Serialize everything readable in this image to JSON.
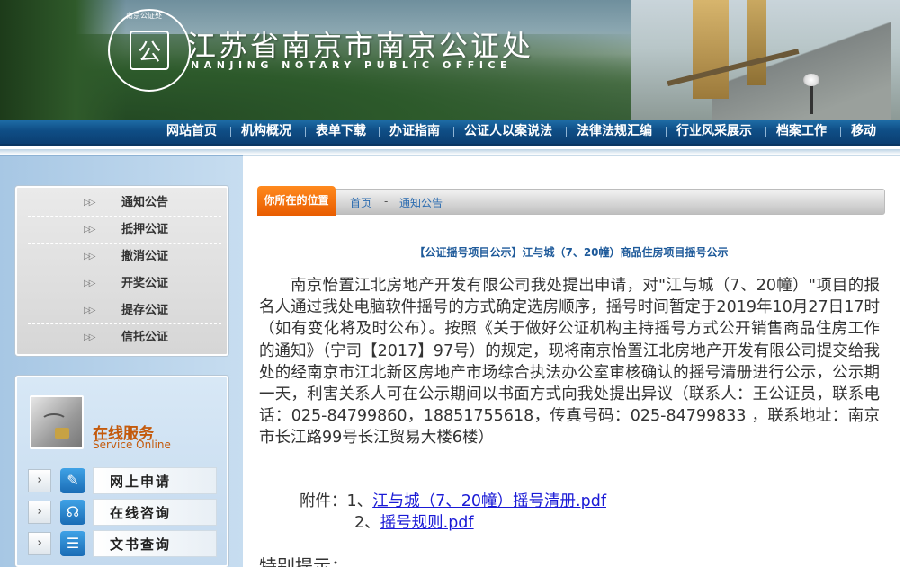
{
  "header": {
    "title_cn": "江苏省南京市南京公证处",
    "title_en": "NANJING NOTARY PUBLIC OFFICE",
    "seal_text_top": "南京公证处",
    "seal_text_ring": "NANJING NOTARY PUBLIC OFFICE"
  },
  "nav": {
    "items": [
      "网站首页",
      "机构概况",
      "表单下载",
      "办证指南",
      "公证人以案说法",
      "法律法规汇编",
      "行业风采展示",
      "档案工作",
      "移动"
    ]
  },
  "sidebar": {
    "menu": [
      {
        "arrow": "▷▷",
        "label": "通知公告"
      },
      {
        "arrow": "▷▷",
        "label": "抵押公证"
      },
      {
        "arrow": "▷▷",
        "label": "撤消公证"
      },
      {
        "arrow": "▷▷",
        "label": "开奖公证"
      },
      {
        "arrow": "▷▷",
        "label": "提存公证"
      },
      {
        "arrow": "▷▷",
        "label": "信托公证"
      }
    ],
    "service": {
      "title": "在线服务",
      "subtitle": "Service Online",
      "items": [
        {
          "label": "网上申请",
          "icon": "edit-icon"
        },
        {
          "label": "在线咨询",
          "icon": "headset-icon"
        },
        {
          "label": "文书查询",
          "icon": "document-list-icon"
        }
      ]
    }
  },
  "breadcrumb": {
    "tag": "你所在的位置",
    "home": "首页",
    "separator": "-",
    "current": "通知公告"
  },
  "article": {
    "title": "【公证摇号项目公示】江与城（7、20幢）商品住房项目摇号公示",
    "body": "南京怡置江北房地产开发有限公司我处提出申请，对\"江与城（7、20幢）\"项目的报名人通过我处电脑软件摇号的方式确定选房顺序，摇号时间暂定于2019年10月27日17时（如有变化将及时公布）。按照《关于做好公证机构主持摇号方式公开销售商品住房工作的通知》（宁司【2017】97号）的规定，现将南京怡置江北房地产开发有限公司提交给我处的经南京市江北新区房地产市场综合执法办公室审核确认的摇号清册进行公示，公示期一天，利害关系人可在公示期间以书面方式向我处提出异议（联系人：王公证员，联系电话：025-84799860，18851755618，传真号码：025-84799833 ，联系地址：南京市长江路99号长江贸易大楼6楼）",
    "attach_prefix": "附件：1、",
    "attach1": "江与城（7、20幢）摇号清册.pdf",
    "attach2_prefix": "2、",
    "attach2": "摇号规则.pdf",
    "special": "特别提示："
  },
  "colors": {
    "nav_bg": "#0f4e86",
    "crumb_tag": "#f07010",
    "link": "#1a1ad6",
    "service_title": "#c45a0c"
  }
}
